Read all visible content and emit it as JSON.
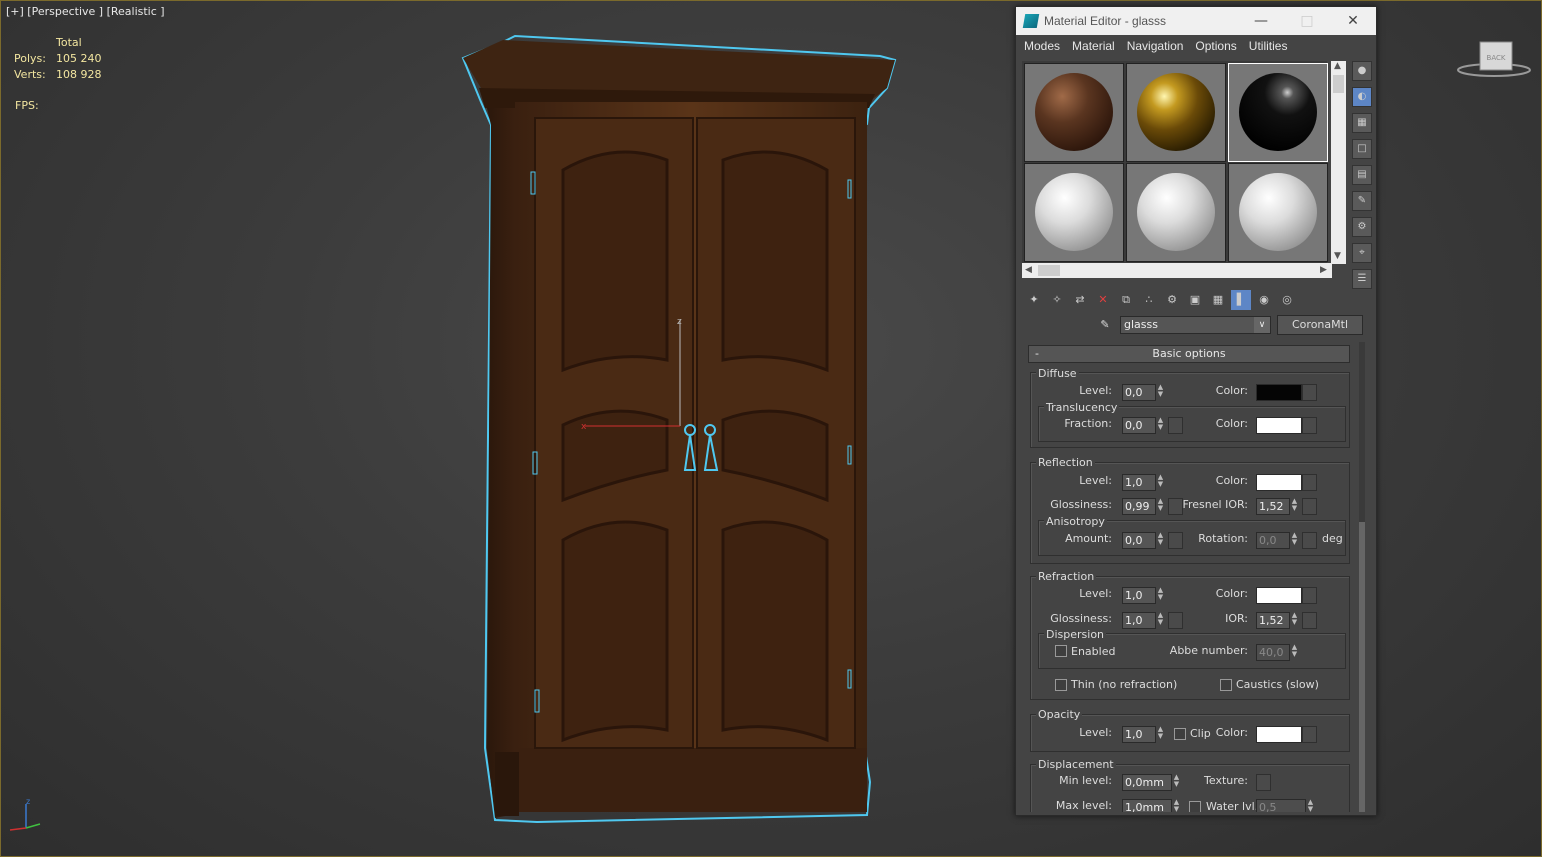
{
  "viewport": {
    "label": "[+] [Perspective ] [Realistic ]",
    "stats": {
      "header": "Total",
      "polys_label": "Polys:",
      "polys_value": "105 240",
      "verts_label": "Verts:",
      "verts_value": "108 928",
      "fps_label": "FPS:"
    },
    "gizmo_z": "z",
    "gizmo_x": "x",
    "viewcube_label": "BACK"
  },
  "material_editor": {
    "title": "Material Editor - glasss",
    "menu": [
      "Modes",
      "Material",
      "Navigation",
      "Options",
      "Utilities"
    ],
    "slots": [
      {
        "name": "dark-wood",
        "color": "#5a3520"
      },
      {
        "name": "gold",
        "color": "#8a6a10"
      },
      {
        "name": "black-gloss",
        "color": "#111111"
      },
      {
        "name": "white-1",
        "color": "#dcdcdc"
      },
      {
        "name": "white-2",
        "color": "#dcdcdc"
      },
      {
        "name": "white-3",
        "color": "#dcdcdc"
      }
    ],
    "material_name": "glasss",
    "material_type": "CoronaMtl",
    "rollout_title": "Basic options",
    "diffuse": {
      "title": "Diffuse",
      "level_label": "Level:",
      "level": "0,0",
      "color_label": "Color:",
      "color": "#050505",
      "translucency": {
        "title": "Translucency",
        "fraction_label": "Fraction:",
        "fraction": "0,0",
        "color_label": "Color:",
        "color": "#ffffff"
      }
    },
    "reflection": {
      "title": "Reflection",
      "level_label": "Level:",
      "level": "1,0",
      "color_label": "Color:",
      "color": "#ffffff",
      "glossiness_label": "Glossiness:",
      "glossiness": "0,99",
      "fresnel_label": "Fresnel IOR:",
      "fresnel": "1,52",
      "anisotropy": {
        "title": "Anisotropy",
        "amount_label": "Amount:",
        "amount": "0,0",
        "rotation_label": "Rotation:",
        "rotation": "0,0",
        "unit": "deg"
      }
    },
    "refraction": {
      "title": "Refraction",
      "level_label": "Level:",
      "level": "1,0",
      "color_label": "Color:",
      "color": "#ffffff",
      "glossiness_label": "Glossiness:",
      "glossiness": "1,0",
      "ior_label": "IOR:",
      "ior": "1,52",
      "dispersion": {
        "title": "Dispersion",
        "enabled_label": "Enabled",
        "abbe_label": "Abbe number:",
        "abbe": "40,0"
      },
      "thin_label": "Thin (no refraction)",
      "caustics_label": "Caustics (slow)"
    },
    "opacity": {
      "title": "Opacity",
      "level_label": "Level:",
      "level": "1,0",
      "clip_label": "Clip",
      "color_label": "Color:",
      "color": "#ffffff"
    },
    "displacement": {
      "title": "Displacement",
      "min_label": "Min level:",
      "min": "0,0mm",
      "texture_label": "Texture:",
      "max_label": "Max level:",
      "max": "1,0mm",
      "water_label": "Water lvl.",
      "water": "0,5"
    }
  }
}
